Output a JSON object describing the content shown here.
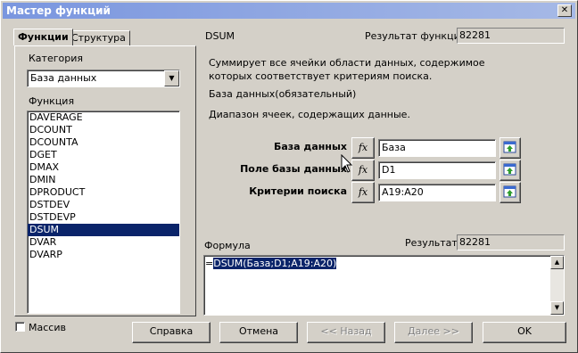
{
  "window": {
    "title": "Мастер функций",
    "close_label": "✕"
  },
  "tabs": [
    {
      "label": "Функции"
    },
    {
      "label": "Структура"
    }
  ],
  "left": {
    "category_label": "Категория",
    "category_value": "База данных",
    "function_label": "Функция",
    "functions": [
      "DAVERAGE",
      "DCOUNT",
      "DCOUNTA",
      "DGET",
      "DMAX",
      "DMIN",
      "DPRODUCT",
      "DSTDEV",
      "DSTDEVP",
      "DSUM",
      "DVAR",
      "DVARP"
    ],
    "selected_function": "DSUM"
  },
  "right": {
    "function_name": "DSUM",
    "result_label": "Результат функции",
    "result_value": "82281",
    "description": "Суммирует все ячейки области данных, содержимое которых соответствует критериям поиска.",
    "arg_title": "База данных(обязательный)",
    "arg_description": "Диапазон ячеек, содержащих данные.",
    "args": [
      {
        "name": "База данных",
        "value": "База"
      },
      {
        "name": "Поле базы данных",
        "value": "D1"
      },
      {
        "name": "Критерии поиска",
        "value": "A19:A20"
      }
    ],
    "fx_label": "fx",
    "formula_label": "Формула",
    "result2_label": "Результат",
    "result2_value": "82281",
    "formula_prefix": "=",
    "formula_selected": "DSUM(База;D1;A19:A20)"
  },
  "footer": {
    "array_label": "Массив",
    "array_checked": false,
    "help_label": "Справка",
    "cancel_label": "Отмена",
    "back_label": "<< Назад",
    "next_label": "Далее >>",
    "ok_label": "OK"
  }
}
